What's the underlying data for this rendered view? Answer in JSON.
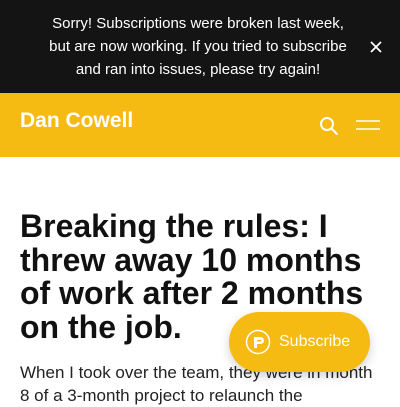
{
  "banner": {
    "message": "Sorry! Subscriptions were broken last week, but are now working. If you tried to subscribe and ran into issues, please try again!",
    "close_icon": "close-icon"
  },
  "header": {
    "site_title": "Dan Cowell",
    "search_icon": "search-icon",
    "menu_icon": "menu-icon"
  },
  "article": {
    "headline": "Breaking the rules: I threw away 10 months of work after 2 months on the job.",
    "body": "When I took over the team, they were in month 8 of a 3-month project to relaunch the"
  },
  "subscribe": {
    "label": "Subscribe",
    "icon": "substack-icon"
  },
  "colors": {
    "banner_bg": "#141414",
    "accent": "#f5bb12"
  }
}
